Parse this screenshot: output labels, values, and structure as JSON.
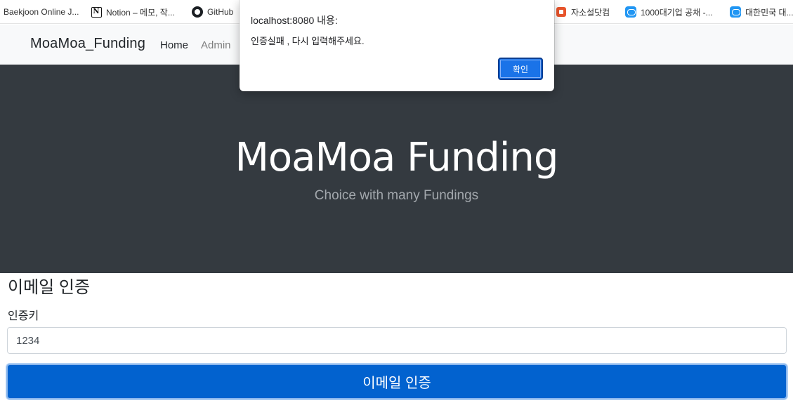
{
  "bookmarks": [
    {
      "label": "Baekjoon Online J...",
      "icon": "none"
    },
    {
      "label": "Notion – 메모, 작...",
      "icon": "notion-icon"
    },
    {
      "label": "GitHub",
      "icon": "github-icon"
    },
    {
      "label": "자소설닷컴",
      "icon": "jasoseol-icon"
    },
    {
      "label": "1000대기업 공채 -...",
      "icon": "chat-bubble-icon"
    },
    {
      "label": "대한민국 대...",
      "icon": "chat-bubble-icon"
    }
  ],
  "navbar": {
    "brand": "MoaMoa_Funding",
    "links": [
      "Home",
      "Admin"
    ]
  },
  "hero": {
    "title": "MoaMoa Funding",
    "subtitle": "Choice with many Fundings",
    "bg_color": "#343a40"
  },
  "form": {
    "title": "이메일 인증",
    "label": "인증키",
    "input_value": "1234",
    "submit_label": "이메일 인증",
    "accent_color": "#0262cf"
  },
  "dialog": {
    "title": "localhost:8080 내용:",
    "message": "인증실패 , 다시 입력해주세요.",
    "ok_label": "확인",
    "accent_color": "#1a73e8"
  }
}
